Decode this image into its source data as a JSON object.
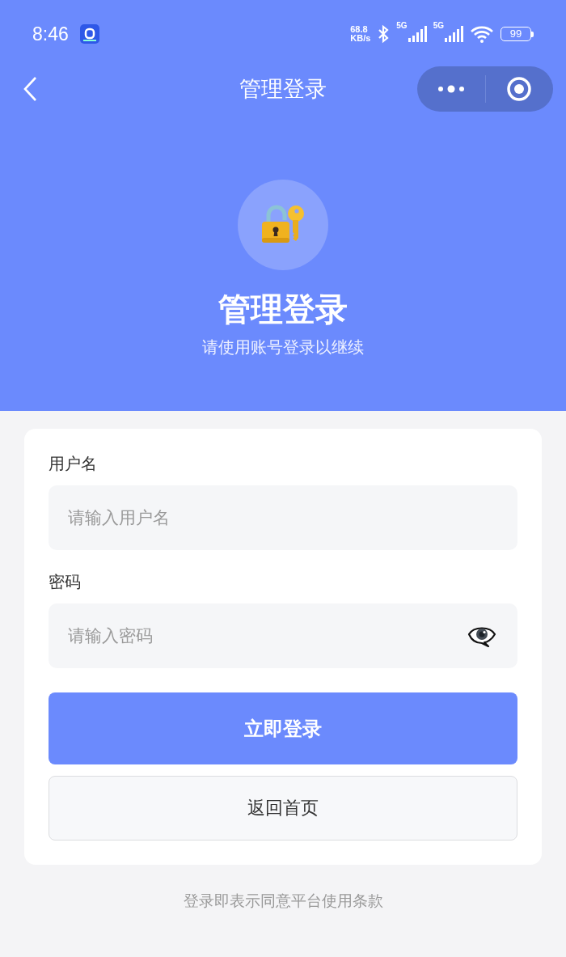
{
  "status_bar": {
    "time": "8:46",
    "net_speed": [
      "68.8",
      "KB/s"
    ],
    "networks": [
      "5G",
      "5G"
    ],
    "battery": "99"
  },
  "nav": {
    "title": "管理登录"
  },
  "hero": {
    "title": "管理登录",
    "subtitle": "请使用账号登录以继续"
  },
  "fields": [
    {
      "kind": "text",
      "label": "用户名",
      "placeholder": "请输入用户名"
    },
    {
      "kind": "password",
      "label": "密码",
      "placeholder": "请输入密码"
    }
  ],
  "buttons": [
    {
      "kind": "primary",
      "label": "立即登录"
    },
    {
      "kind": "secondary",
      "label": "返回首页"
    }
  ],
  "footer": "登录即表示同意平台使用条款"
}
